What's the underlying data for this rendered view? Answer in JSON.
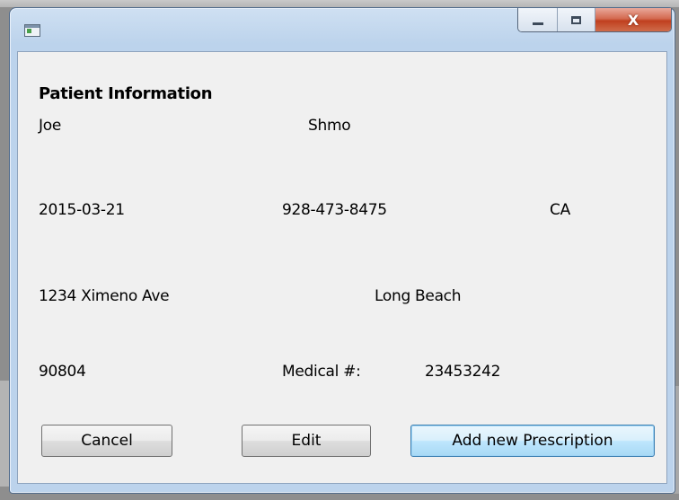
{
  "window": {
    "icon": "app-window-icon",
    "controls": {
      "minimize": "minimize-icon",
      "maximize": "maximize-icon",
      "close": "close-icon",
      "close_glyph": "X"
    }
  },
  "patient": {
    "heading": "Patient Information",
    "first_name": "Joe",
    "last_name": "Shmo",
    "date_of_birth": "2015-03-21",
    "phone": "928-473-8475",
    "state": "CA",
    "street": "1234 Ximeno Ave",
    "city": "Long Beach",
    "zip": "90804",
    "medical_label": "Medical #:",
    "medical_number": "23453242"
  },
  "buttons": {
    "cancel": "Cancel",
    "edit": "Edit",
    "add_prescription": "Add new Prescription"
  },
  "colors": {
    "window_frame": "#bcd3ec",
    "client_bg": "#f0f0f0",
    "close_button": "#c0401f",
    "focused_button": "#bee6fd"
  }
}
